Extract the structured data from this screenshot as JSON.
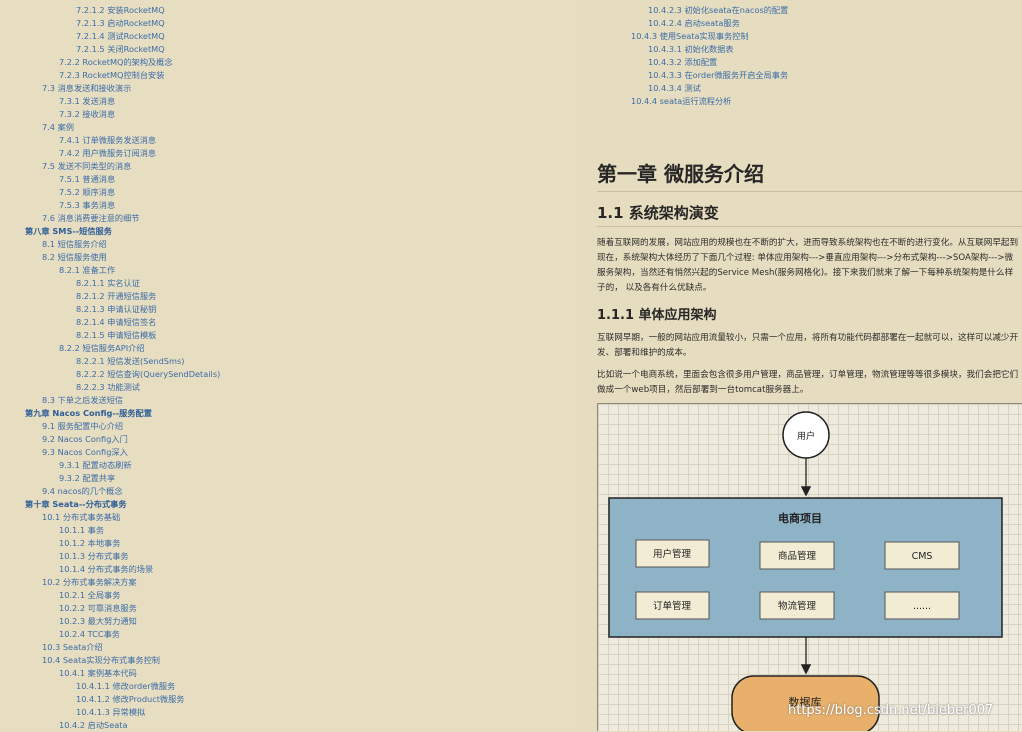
{
  "toc_left": [
    {
      "text": "7.2.1.2 安装RocketMQ",
      "level": 4
    },
    {
      "text": "7.2.1.3 启动RocketMQ",
      "level": 4
    },
    {
      "text": "7.2.1.4 测试RocketMQ",
      "level": 4
    },
    {
      "text": "7.2.1.5 关闭RocketMQ",
      "level": 4
    },
    {
      "text": "7.2.2 RocketMQ的架构及概念",
      "level": 3
    },
    {
      "text": "7.2.3 RocketMQ控制台安装",
      "level": 3
    },
    {
      "text": "7.3 消息发送和接收演示",
      "level": 2
    },
    {
      "text": "7.3.1 发送消息",
      "level": 3
    },
    {
      "text": "7.3.2 接收消息",
      "level": 3
    },
    {
      "text": "7.4 案例",
      "level": 2
    },
    {
      "text": "7.4.1 订单微服务发送消息",
      "level": 3
    },
    {
      "text": "7.4.2 用户微服务订阅消息",
      "level": 3
    },
    {
      "text": "7.5 发送不同类型的消息",
      "level": 2
    },
    {
      "text": "7.5.1 普通消息",
      "level": 3
    },
    {
      "text": "7.5.2 顺序消息",
      "level": 3
    },
    {
      "text": "7.5.3 事务消息",
      "level": 3
    },
    {
      "text": "7.6 消息消费要注意的细节",
      "level": 2
    },
    {
      "text": "第八章 SMS--短信服务",
      "level": 1
    },
    {
      "text": "8.1 短信服务介绍",
      "level": 2
    },
    {
      "text": "8.2 短信服务使用",
      "level": 2
    },
    {
      "text": "8.2.1 准备工作",
      "level": 3
    },
    {
      "text": "8.2.1.1 实名认证",
      "level": 4
    },
    {
      "text": "8.2.1.2 开通短信服务",
      "level": 4
    },
    {
      "text": "8.2.1.3 申请认证秘钥",
      "level": 4
    },
    {
      "text": "8.2.1.4 申请短信签名",
      "level": 4
    },
    {
      "text": "8.2.1.5 申请短信模板",
      "level": 4
    },
    {
      "text": "8.2.2 短信服务API介绍",
      "level": 3
    },
    {
      "text": "8.2.2.1 短信发送(SendSms)",
      "level": 4
    },
    {
      "text": "8.2.2.2 短信查询(QuerySendDetails)",
      "level": 4
    },
    {
      "text": "8.2.2.3 功能测试",
      "level": 4
    },
    {
      "text": "8.3 下单之后发送短信",
      "level": 2
    },
    {
      "text": "第九章 Nacos Config--服务配置",
      "level": 1
    },
    {
      "text": "9.1 服务配置中心介绍",
      "level": 2
    },
    {
      "text": "9.2 Nacos Config入门",
      "level": 2
    },
    {
      "text": "9.3 Nacos Config深入",
      "level": 2
    },
    {
      "text": "9.3.1 配置动态刷新",
      "level": 3
    },
    {
      "text": "9.3.2 配置共享",
      "level": 3
    },
    {
      "text": "9.4 nacos的几个概念",
      "level": 2
    },
    {
      "text": "第十章 Seata--分布式事务",
      "level": 1
    },
    {
      "text": "10.1 分布式事务基础",
      "level": 2
    },
    {
      "text": "10.1.1 事务",
      "level": 3
    },
    {
      "text": "10.1.2 本地事务",
      "level": 3
    },
    {
      "text": "10.1.3 分布式事务",
      "level": 3
    },
    {
      "text": "10.1.4 分布式事务的场景",
      "level": 3
    },
    {
      "text": "10.2 分布式事务解决方案",
      "level": 2
    },
    {
      "text": "10.2.1 全局事务",
      "level": 3
    },
    {
      "text": "10.2.2 可靠消息服务",
      "level": 3
    },
    {
      "text": "10.2.3 最大努力通知",
      "level": 3
    },
    {
      "text": "10.2.4 TCC事务",
      "level": 3
    },
    {
      "text": "10.3 Seata介绍",
      "level": 2
    },
    {
      "text": "10.4 Seata实现分布式事务控制",
      "level": 2
    },
    {
      "text": "10.4.1 案例基本代码",
      "level": 3
    },
    {
      "text": "10.4.1.1 修改order微服务",
      "level": 4
    },
    {
      "text": "10.4.1.2 修改Product微服务",
      "level": 4
    },
    {
      "text": "10.4.1.3 异常模拟",
      "level": 4
    },
    {
      "text": "10.4.2 启动Seata",
      "level": 3
    }
  ],
  "toc_right": [
    {
      "text": "10.4.2.3 初始化seata在nacos的配置",
      "level": 4
    },
    {
      "text": "10.4.2.4 启动seata服务",
      "level": 4
    },
    {
      "text": "10.4.3 使用Seata实现事务控制",
      "level": 3
    },
    {
      "text": "10.4.3.1 初始化数据表",
      "level": 4
    },
    {
      "text": "10.4.3.2 添加配置",
      "level": 4
    },
    {
      "text": "10.4.3.3 在order微服务开启全局事务",
      "level": 4
    },
    {
      "text": "10.4.3.4 测试",
      "level": 4
    },
    {
      "text": "10.4.4 seata运行流程分析",
      "level": 3
    }
  ],
  "chapter_title": "第一章 微服务介绍",
  "section_title": "1.1 系统架构演变",
  "intro_paragraph": "随着互联网的发展，网站应用的规模也在不断的扩大，进而导致系统架构也在不断的进行变化。从互联网早起到现在，系统架构大体经历了下面几个过程: 单体应用架构--->垂直应用架构--->分布式架构--->SOA架构--->微服务架构，当然还有悄然兴起的Service Mesh(服务网格化)。接下来我们就来了解一下每种系统架构是什么样子的， 以及各有什么优缺点。",
  "subsection_title": "1.1.1 单体应用架构",
  "paragraph_2": "互联网早期，一般的网站应用流量较小，只需一个应用，将所有功能代码都部署在一起就可以，这样可以减少开发、部署和维护的成本。",
  "paragraph_3": "比如说一个电商系统，里面会包含很多用户管理，商品管理，订单管理，物流管理等等很多模块，我们会把它们做成一个web项目，然后部署到一台tomcat服务器上。",
  "diagram": {
    "user_label": "用户",
    "project_label": "电商项目",
    "modules": [
      "用户管理",
      "商品管理",
      "CMS",
      "订单管理",
      "物流管理",
      "......"
    ],
    "db_label": "数据库"
  },
  "watermark": "https://blog.csdn.net/bieber007",
  "colors": {
    "link": "#3b6da8",
    "project_box": "#8eb3c6",
    "db_box": "#e8b06a",
    "page": "#e6dcbf"
  }
}
